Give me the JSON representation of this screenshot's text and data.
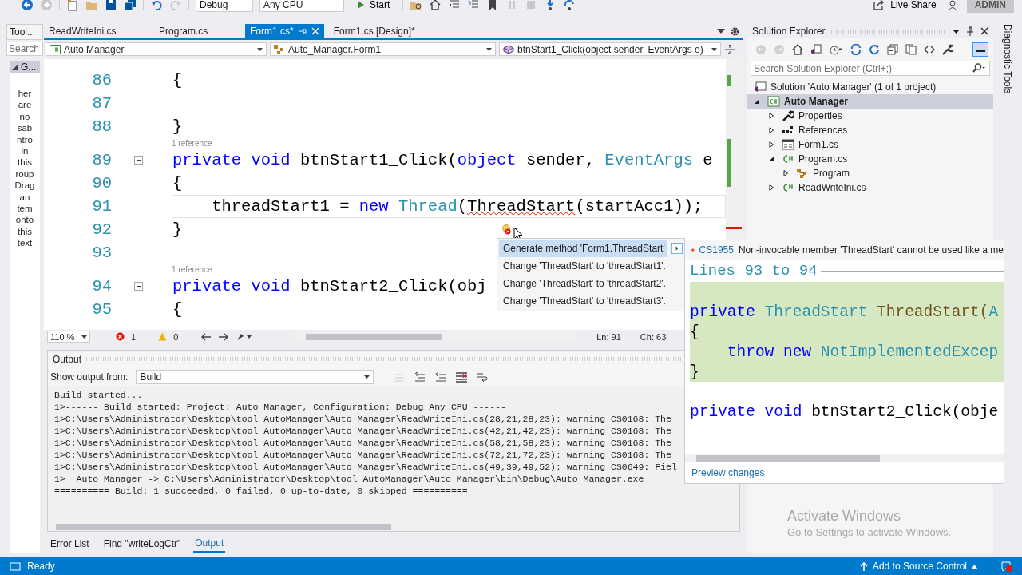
{
  "toolbar": {
    "config": "Debug",
    "platform": "Any CPU",
    "start": "Start",
    "live_share": "Live Share",
    "user": "ADMIN"
  },
  "toolbox": {
    "title": "Tool...",
    "search": {
      "placeholder": "Search"
    },
    "group": "G...",
    "group_expanded": true,
    "message_fragments": [
      "her",
      "are",
      "no",
      "sab",
      "ntro",
      "in",
      "this",
      "roup",
      "Drag",
      "an",
      "tem",
      "onto",
      "this",
      "text"
    ]
  },
  "editor": {
    "tabs": [
      {
        "label": "ReadWriteIni.cs",
        "selected": false
      },
      {
        "label": "Program.cs",
        "selected": false
      },
      {
        "label": "Form1.cs*",
        "selected": true
      },
      {
        "label": "Form1.cs [Design]*",
        "selected": false
      }
    ],
    "nav": {
      "project": "Auto Manager",
      "type": "Auto_Manager.Form1",
      "member": "btnStart1_Click(object sender, EventArgs e)"
    },
    "lines": [
      {
        "kind": "code",
        "num": "86",
        "fold": false,
        "current": false,
        "tokens": [
          {
            "kind": "plain",
            "text": "{"
          }
        ]
      },
      {
        "kind": "code",
        "num": "87",
        "fold": false,
        "current": false
      },
      {
        "kind": "code",
        "num": "88",
        "fold": false,
        "current": false,
        "tokens": [
          {
            "kind": "plain",
            "text": "}"
          }
        ]
      },
      {
        "kind": "lens",
        "text": "1 reference"
      },
      {
        "kind": "code",
        "num": "89",
        "fold": true,
        "current": false,
        "tokens": [
          {
            "kind": "keyword",
            "text": "private void "
          },
          {
            "kind": "plain",
            "text": "btnStart1_Click("
          },
          {
            "kind": "keyword",
            "text": "object"
          },
          {
            "kind": "plain",
            "text": " sender, "
          },
          {
            "kind": "type",
            "text": "EventArgs"
          },
          {
            "kind": "plain",
            "text": " e"
          }
        ]
      },
      {
        "kind": "code",
        "num": "90",
        "fold": false,
        "current": false,
        "tokens": [
          {
            "kind": "plain",
            "text": "{"
          }
        ]
      },
      {
        "kind": "code",
        "num": "91",
        "fold": false,
        "current": true,
        "tokens": [
          {
            "kind": "plain",
            "text": "    threadStart1 = "
          },
          {
            "kind": "keyword",
            "text": "new "
          },
          {
            "kind": "type",
            "text": "Thread"
          },
          {
            "kind": "plain",
            "text": "("
          },
          {
            "kind": "error",
            "text": "ThreadStart"
          },
          {
            "kind": "plain",
            "text": "(startAcc1));"
          }
        ]
      },
      {
        "kind": "code",
        "num": "92",
        "fold": false,
        "current": false,
        "tokens": [
          {
            "kind": "plain",
            "text": "}"
          }
        ]
      },
      {
        "kind": "code",
        "num": "93",
        "fold": false,
        "current": false
      },
      {
        "kind": "lens",
        "text": "1 reference"
      },
      {
        "kind": "code",
        "num": "94",
        "fold": true,
        "current": false,
        "tokens": [
          {
            "kind": "keyword",
            "text": "private void "
          },
          {
            "kind": "plain",
            "text": "btnStart2_Click(obj"
          }
        ]
      },
      {
        "kind": "code",
        "num": "95",
        "fold": false,
        "current": false,
        "tokens": [
          {
            "kind": "plain",
            "text": "{"
          }
        ]
      }
    ],
    "zoom": "110 %",
    "errors": "1",
    "warnings": "0",
    "line": "Ln: 91",
    "col": "Ch: 63"
  },
  "quick_actions": {
    "items": [
      {
        "label": "Generate method 'Form1.ThreadStart'",
        "selected": true
      },
      {
        "label": "Change 'ThreadStart' to 'threadStart1'.",
        "selected": false
      },
      {
        "label": "Change 'ThreadStart' to 'threadStart2'.",
        "selected": false
      },
      {
        "label": "Change 'ThreadStart' to 'threadStart3'.",
        "selected": false
      }
    ]
  },
  "preview": {
    "code": "CS1955",
    "message": "Non-invocable member 'ThreadStart' cannot be used like a me",
    "range": "Lines 93 to 94",
    "lines": [
      {
        "kind": "added"
      },
      {
        "kind": "added",
        "tokens": [
          {
            "kind": "keyword",
            "text": "private "
          },
          {
            "kind": "type",
            "text": "ThreadStart"
          },
          {
            "kind": "method",
            "text": " ThreadStart("
          },
          {
            "kind": "type",
            "text": "A"
          }
        ]
      },
      {
        "kind": "added",
        "tokens": [
          {
            "kind": "plain",
            "text": "{"
          }
        ]
      },
      {
        "kind": "added",
        "tokens": [
          {
            "kind": "keyword",
            "text": "    throw new "
          },
          {
            "kind": "type",
            "text": "NotImplementedExcep"
          }
        ]
      },
      {
        "kind": "added",
        "tokens": [
          {
            "kind": "plain",
            "text": "}"
          }
        ]
      },
      {
        "kind": "context"
      },
      {
        "kind": "context",
        "tokens": [
          {
            "kind": "keyword",
            "text": "private void "
          },
          {
            "kind": "plain",
            "text": "btnStart2_Click(obje"
          }
        ]
      }
    ],
    "link": "Preview changes"
  },
  "output": {
    "title": "Output",
    "source_label": "Show output from:",
    "source": "Build",
    "lines": [
      "Build started...",
      "1>------ Build started: Project: Auto Manager, Configuration: Debug Any CPU ------",
      "1>C:\\Users\\Administrator\\Desktop\\tool AutoManager\\Auto Manager\\ReadWriteIni.cs(28,21,28,23): warning CS0168: The",
      "1>C:\\Users\\Administrator\\Desktop\\tool AutoManager\\Auto Manager\\ReadWriteIni.cs(42,21,42,23): warning CS0168: The",
      "1>C:\\Users\\Administrator\\Desktop\\tool AutoManager\\Auto Manager\\ReadWriteIni.cs(58,21,58,23): warning CS0168: The",
      "1>C:\\Users\\Administrator\\Desktop\\tool AutoManager\\Auto Manager\\ReadWriteIni.cs(72,21,72,23): warning CS0168: The",
      "1>C:\\Users\\Administrator\\Desktop\\tool AutoManager\\Auto Manager\\ReadWriteIni.cs(49,39,49,52): warning CS0649: Fiel",
      "1>  Auto Manager -> C:\\Users\\Administrator\\Desktop\\tool AutoManager\\Auto Manager\\bin\\Debug\\Auto Manager.exe",
      "========== Build: 1 succeeded, 0 failed, 0 up-to-date, 0 skipped =========="
    ]
  },
  "bottom_tabs": [
    {
      "label": "Error List",
      "selected": false
    },
    {
      "label": "Find \"writeLogCtr\"",
      "selected": false
    },
    {
      "label": "Output",
      "selected": true
    }
  ],
  "solution_explorer": {
    "title": "Solution Explorer",
    "search": {
      "placeholder": "Search Solution Explorer (Ctrl+;)"
    },
    "tree": [
      {
        "kind": "solution",
        "label": "Solution 'Auto Manager' (1 of 1 project)",
        "selected": false,
        "children": [
          {
            "kind": "project",
            "label": "Auto Manager",
            "expanded": true,
            "selected": true,
            "children": [
              {
                "kind": "properties",
                "label": "Properties",
                "expanded": false,
                "selected": false
              },
              {
                "kind": "references",
                "label": "References",
                "expanded": false,
                "selected": false
              },
              {
                "kind": "form",
                "label": "Form1.cs",
                "expanded": false,
                "selected": false
              },
              {
                "kind": "csharp",
                "label": "Program.cs",
                "expanded": true,
                "selected": false,
                "children": [
                  {
                    "kind": "class",
                    "label": "Program",
                    "expanded": false,
                    "selected": false
                  }
                ]
              },
              {
                "kind": "csharp",
                "label": "ReadWriteIni.cs",
                "expanded": false,
                "selected": false
              }
            ]
          }
        ]
      }
    ]
  },
  "diagnostic_tools": "Diagnostic Tools",
  "activation": {
    "title": "Activate Windows",
    "hint": "Go to Settings to activate Windows."
  },
  "status_bar": {
    "text": "Ready",
    "source_control": "Add to Source Control"
  }
}
